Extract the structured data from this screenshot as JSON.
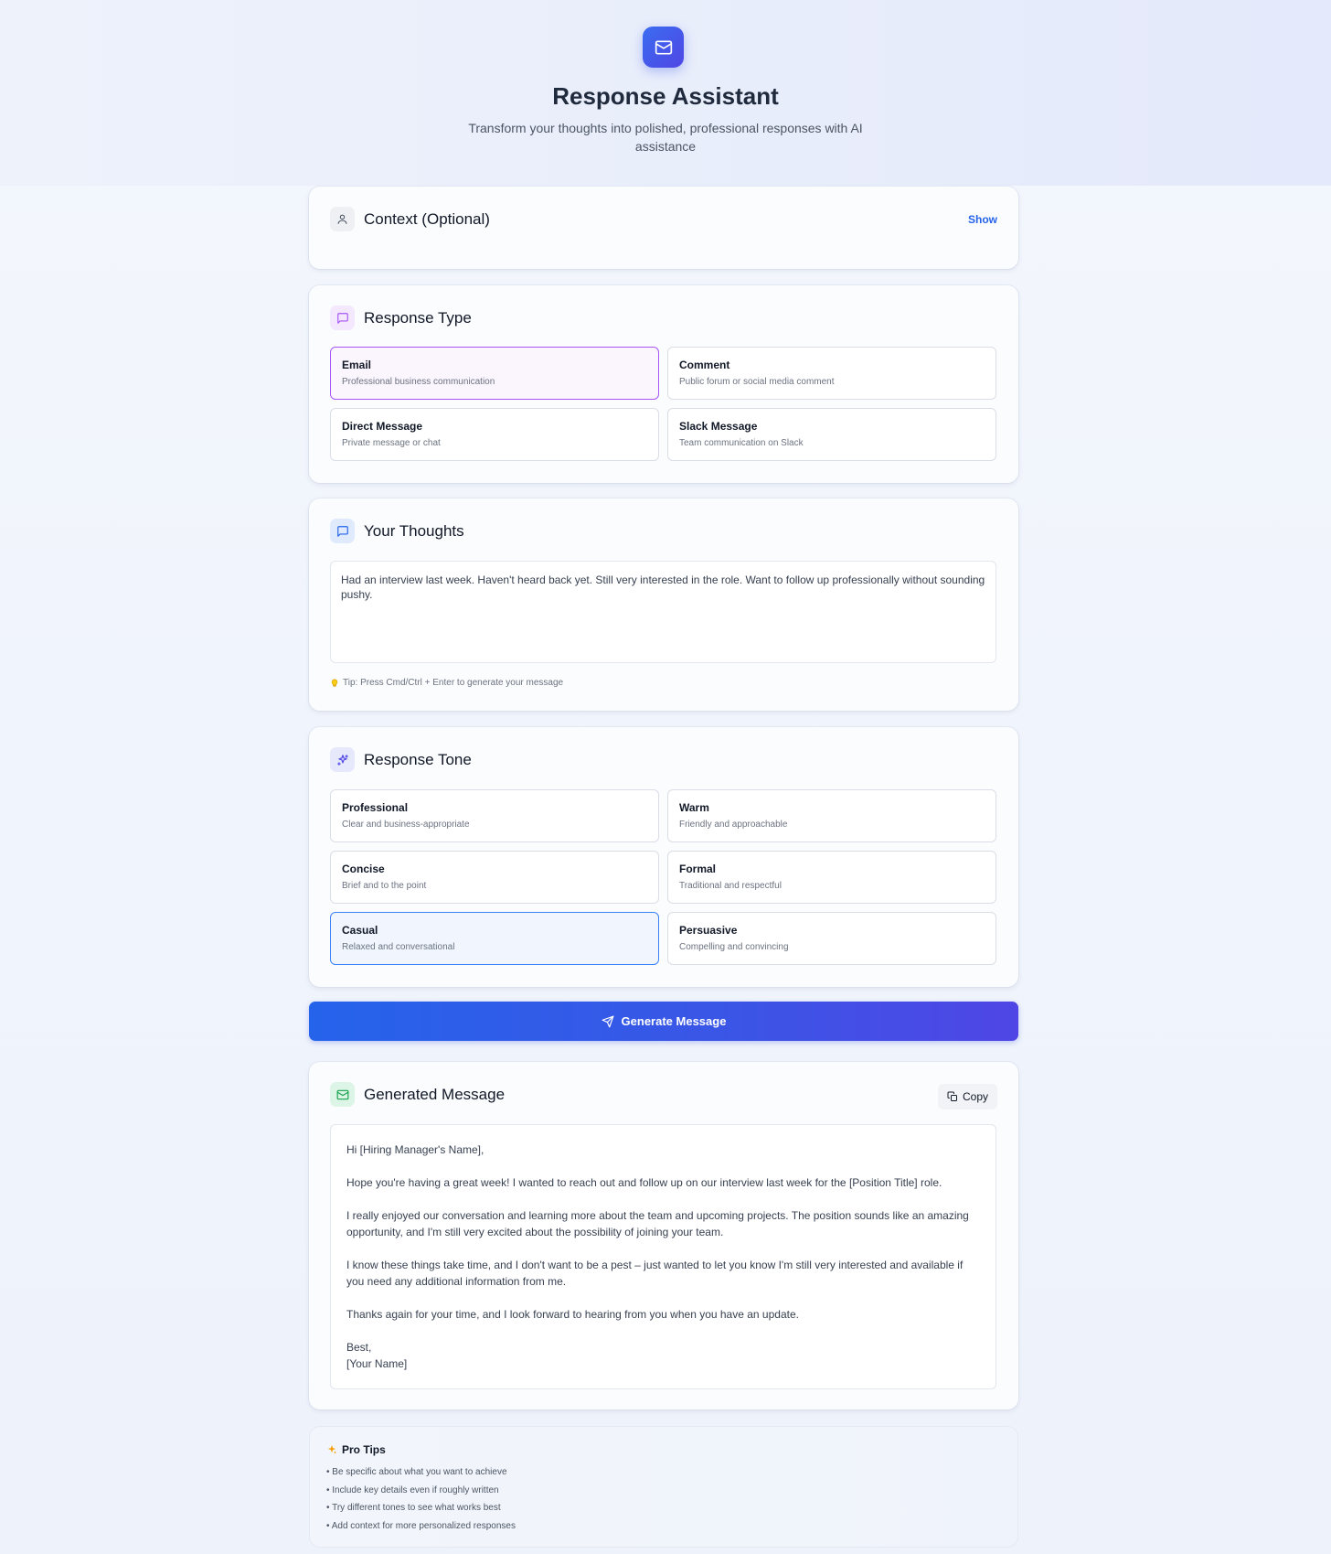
{
  "hero": {
    "icon": "mail-icon",
    "title": "Response Assistant",
    "subtitle": "Transform your thoughts into polished, professional responses with AI assistance"
  },
  "context": {
    "icon": "user-icon",
    "title": "Context (Optional)",
    "toggle_label": "Show"
  },
  "response_type": {
    "icon": "message-square-icon",
    "title": "Response Type",
    "selected": "Email",
    "options": [
      {
        "title": "Email",
        "desc": "Professional business communication"
      },
      {
        "title": "Comment",
        "desc": "Public forum or social media comment"
      },
      {
        "title": "Direct Message",
        "desc": "Private message or chat"
      },
      {
        "title": "Slack Message",
        "desc": "Team communication on Slack"
      }
    ]
  },
  "thoughts": {
    "icon": "message-square-icon",
    "title": "Your Thoughts",
    "value": "Had an interview last week. Haven't heard back yet. Still very interested in the role. Want to follow up professionally without sounding pushy.",
    "tip": "Tip: Press Cmd/Ctrl + Enter to generate your message"
  },
  "tone": {
    "icon": "sparkles-icon",
    "title": "Response Tone",
    "selected": "Casual",
    "options": [
      {
        "title": "Professional",
        "desc": "Clear and business-appropriate"
      },
      {
        "title": "Warm",
        "desc": "Friendly and approachable"
      },
      {
        "title": "Concise",
        "desc": "Brief and to the point"
      },
      {
        "title": "Formal",
        "desc": "Traditional and respectful"
      },
      {
        "title": "Casual",
        "desc": "Relaxed and conversational"
      },
      {
        "title": "Persuasive",
        "desc": "Compelling and convincing"
      }
    ]
  },
  "generate": {
    "icon": "send-icon",
    "label": "Generate Message"
  },
  "generated": {
    "icon": "mail-icon",
    "title": "Generated Message",
    "copy_label": "Copy",
    "paragraphs": [
      "Hi [Hiring Manager's Name],",
      "Hope you're having a great week! I wanted to reach out and follow up on our interview last week for the [Position Title] role.",
      "I really enjoyed our conversation and learning more about the team and upcoming projects. The position sounds like an amazing opportunity, and I'm still very excited about the possibility of joining your team.",
      "I know these things take time, and I don't want to be a pest – just wanted to let you know I'm still very interested and available if you need any additional information from me.",
      "Thanks again for your time, and I look forward to hearing from you when you have an update.",
      "Best,",
      "[Your Name]"
    ]
  },
  "pro_tips": {
    "icon": "sparkles-icon",
    "title": "Pro Tips",
    "items": [
      "• Be specific about what you want to achieve",
      "• Include key details even if roughly written",
      "• Try different tones to see what works best",
      "• Add context for more personalized responses"
    ]
  },
  "colors": {
    "primary": "#2563eb",
    "indigo": "#4f46e5",
    "selected_type_border": "#a855f7",
    "selected_tone_border": "#3b82f6"
  }
}
